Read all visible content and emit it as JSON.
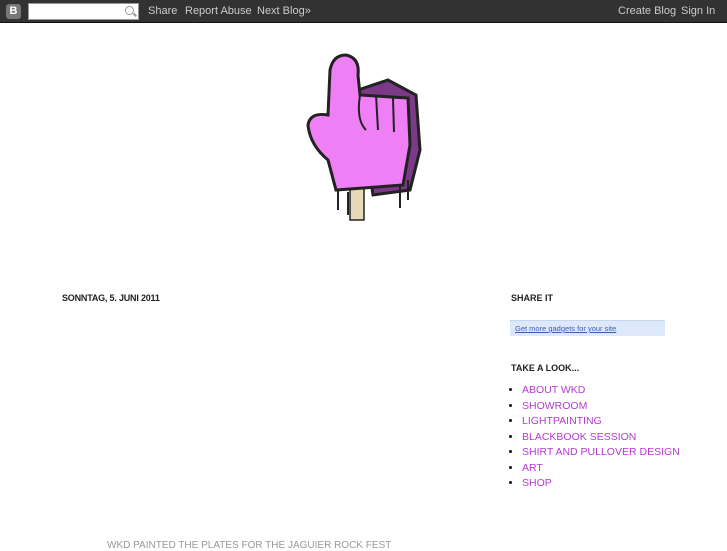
{
  "navbar": {
    "search_placeholder": "",
    "share": "Share",
    "report_abuse": "Report Abuse",
    "next_blog": "Next Blog»",
    "create_blog": "Create Blog",
    "sign_in": "Sign In"
  },
  "post": {
    "date": "SONNTAG, 5. JUNI 2011",
    "title": "WKD PAINTED THE PLATES FOR THE JAGUIER ROCK FEST"
  },
  "sidebar": {
    "share_title": "SHARE IT",
    "gadgets_link": "Get more gadgets for your site",
    "look_title": "TAKE A LOOK...",
    "links": [
      "ABOUT WKD",
      "SHOWROOM",
      "LIGHTPAINTING",
      "BLACKBOOK SESSION",
      "SHIRT AND PULLOVER DESIGN",
      "ART",
      "SHOP"
    ]
  },
  "colors": {
    "navbar": "#323232",
    "link": "#b33bd0",
    "glove": "#ee7ff5"
  }
}
